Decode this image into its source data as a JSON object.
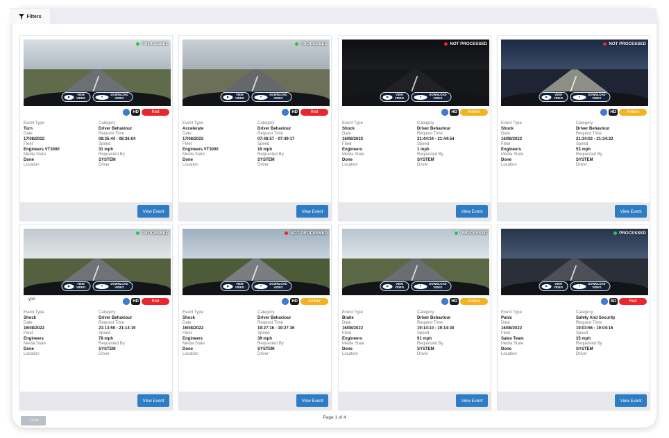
{
  "toolbar": {
    "filters_label": "Filters"
  },
  "field_labels": {
    "event_type": "Event Type",
    "category": "Category",
    "date": "Date",
    "request_time": "Request Time",
    "fleet": "Fleet",
    "speed": "Speed",
    "media_state": "Media State",
    "requested_by": "Requested By",
    "location": "Location",
    "driver": "Driver"
  },
  "buttons": {
    "view_video_line1": "VIEW",
    "view_video_line2": "VIDEO",
    "download_video_line1": "DOWNLOAD",
    "download_video_line2": "VIDEO",
    "view_event": "View Event"
  },
  "status_colors": {
    "processed": "#27c93f",
    "not_processed": "#e8262b"
  },
  "cards": [
    {
      "status": "PROCESSED",
      "processed": true,
      "quality": "HD",
      "severity": "Red",
      "severity_color": "#e8262b",
      "event_type": "Turn",
      "category": "Driver Behaviour",
      "date": "17/08/2022",
      "request_time": "08:35:44 - 08:36:04",
      "fleet": "Engineers VT3000",
      "speed": "31 mph",
      "media_state": "Done",
      "requested_by": "SYSTEM",
      "scene": "day-country"
    },
    {
      "status": "PROCESSED",
      "processed": true,
      "quality": "HD",
      "severity": "Red",
      "severity_color": "#e8262b",
      "event_type": "Accelerate",
      "category": "Driver Behaviour",
      "date": "17/08/2022",
      "request_time": "07:48:57 - 07:49:17",
      "fleet": "Engineers VT3000",
      "speed": "16 mph",
      "media_state": "Done",
      "requested_by": "SYSTEM",
      "scene": "day-town"
    },
    {
      "status": "NOT PROCESSED",
      "processed": false,
      "quality": "HD",
      "severity": "Amber",
      "severity_color": "#f3b321",
      "event_type": "Shock",
      "category": "Driver Behaviour",
      "date": "16/08/2022",
      "request_time": "21:44:34 - 21:44:54",
      "fleet": "Engineers",
      "speed": "1 mph",
      "media_state": "Done",
      "requested_by": "SYSTEM",
      "scene": "night-dark"
    },
    {
      "status": "NOT PROCESSED",
      "processed": false,
      "quality": "HD",
      "severity": "Amber",
      "severity_color": "#f3b321",
      "event_type": "Shock",
      "category": "Driver Behaviour",
      "date": "16/08/2022",
      "request_time": "21:34:02 - 21:34:22",
      "fleet": "Engineers",
      "speed": "53 mph",
      "media_state": "Done",
      "requested_by": "SYSTEM",
      "scene": "night-road"
    },
    {
      "status": "PROCESSED",
      "processed": true,
      "quality": "HD",
      "severity": "Red",
      "severity_color": "#e8262b",
      "partial_label": "-ype",
      "event_type": "Shock",
      "category": "Driver Behaviour",
      "date": "16/08/2022",
      "request_time": "21:13:59 - 21:14:19",
      "fleet": "Engineers",
      "speed": "78 mph",
      "media_state": "Done",
      "requested_by": "SYSTEM",
      "scene": "dusk-road"
    },
    {
      "status": "NOT PROCESSED",
      "processed": false,
      "quality": "HD",
      "severity": "Amber",
      "severity_color": "#f3b321",
      "event_type": "Shock",
      "category": "Driver Behaviour",
      "date": "16/08/2022",
      "request_time": "19:27:16 - 19:27:36",
      "fleet": "Engineers",
      "speed": "39 mph",
      "media_state": "Done",
      "requested_by": "SYSTEM",
      "scene": "day-suburb"
    },
    {
      "status": "PROCESSED",
      "processed": true,
      "quality": "HD",
      "severity": "Amber",
      "severity_color": "#f3b321",
      "event_type": "Brake",
      "category": "Driver Behaviour",
      "date": "16/08/2022",
      "request_time": "19:14:10 - 19:14:30",
      "fleet": "Engineers",
      "speed": "91 mph",
      "media_state": "Done",
      "requested_by": "SYSTEM",
      "scene": "day-highway"
    },
    {
      "status": "PROCESSED",
      "processed": true,
      "quality": "SD",
      "severity": "Red",
      "severity_color": "#e8262b",
      "event_type": "Panic",
      "category": "Safety And Security",
      "date": "16/08/2022",
      "request_time": "19:03:56 - 19:04:16",
      "fleet": "Sales Team",
      "speed": "35 mph",
      "media_state": "Done",
      "requested_by": "SYSTEM",
      "scene": "dusk-detect"
    }
  ],
  "pager": {
    "prev_label": "Prev",
    "page_text": "Page 1 of 4"
  }
}
